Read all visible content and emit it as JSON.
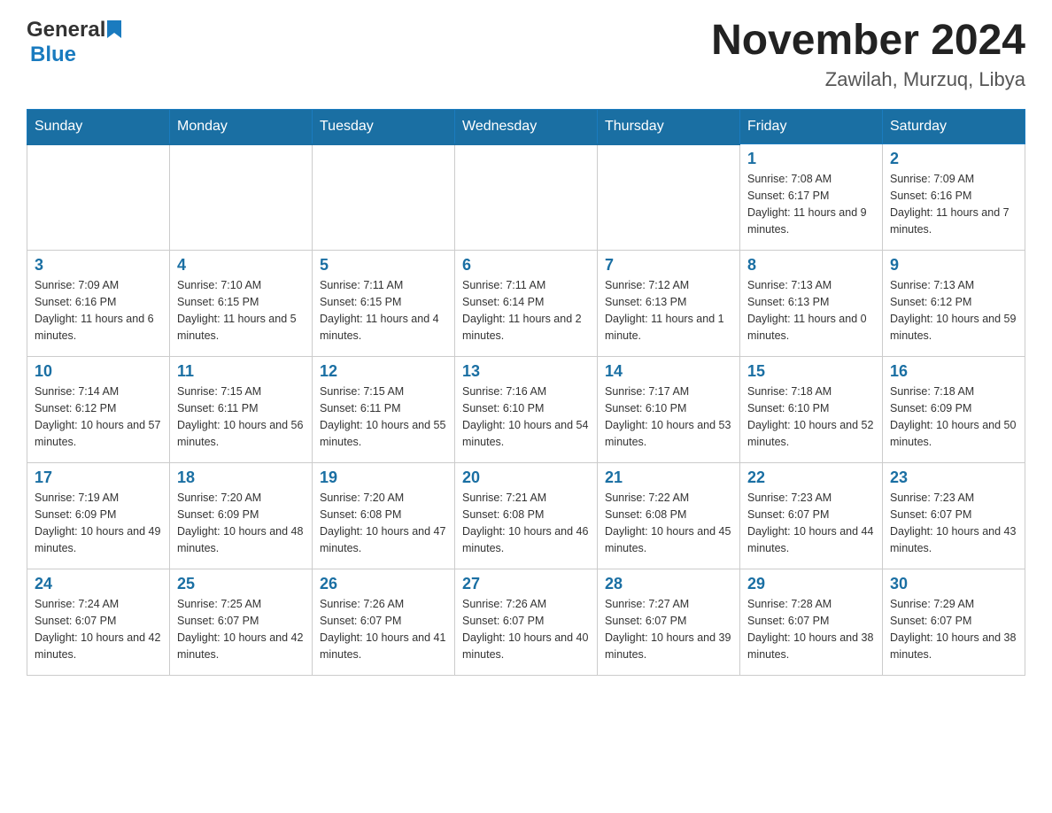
{
  "header": {
    "logo_general": "General",
    "logo_blue": "Blue",
    "month_title": "November 2024",
    "location": "Zawilah, Murzuq, Libya"
  },
  "days_of_week": [
    "Sunday",
    "Monday",
    "Tuesday",
    "Wednesday",
    "Thursday",
    "Friday",
    "Saturday"
  ],
  "weeks": [
    {
      "cells": [
        {
          "day": "",
          "info": ""
        },
        {
          "day": "",
          "info": ""
        },
        {
          "day": "",
          "info": ""
        },
        {
          "day": "",
          "info": ""
        },
        {
          "day": "",
          "info": ""
        },
        {
          "day": "1",
          "info": "Sunrise: 7:08 AM\nSunset: 6:17 PM\nDaylight: 11 hours and 9 minutes."
        },
        {
          "day": "2",
          "info": "Sunrise: 7:09 AM\nSunset: 6:16 PM\nDaylight: 11 hours and 7 minutes."
        }
      ]
    },
    {
      "cells": [
        {
          "day": "3",
          "info": "Sunrise: 7:09 AM\nSunset: 6:16 PM\nDaylight: 11 hours and 6 minutes."
        },
        {
          "day": "4",
          "info": "Sunrise: 7:10 AM\nSunset: 6:15 PM\nDaylight: 11 hours and 5 minutes."
        },
        {
          "day": "5",
          "info": "Sunrise: 7:11 AM\nSunset: 6:15 PM\nDaylight: 11 hours and 4 minutes."
        },
        {
          "day": "6",
          "info": "Sunrise: 7:11 AM\nSunset: 6:14 PM\nDaylight: 11 hours and 2 minutes."
        },
        {
          "day": "7",
          "info": "Sunrise: 7:12 AM\nSunset: 6:13 PM\nDaylight: 11 hours and 1 minute."
        },
        {
          "day": "8",
          "info": "Sunrise: 7:13 AM\nSunset: 6:13 PM\nDaylight: 11 hours and 0 minutes."
        },
        {
          "day": "9",
          "info": "Sunrise: 7:13 AM\nSunset: 6:12 PM\nDaylight: 10 hours and 59 minutes."
        }
      ]
    },
    {
      "cells": [
        {
          "day": "10",
          "info": "Sunrise: 7:14 AM\nSunset: 6:12 PM\nDaylight: 10 hours and 57 minutes."
        },
        {
          "day": "11",
          "info": "Sunrise: 7:15 AM\nSunset: 6:11 PM\nDaylight: 10 hours and 56 minutes."
        },
        {
          "day": "12",
          "info": "Sunrise: 7:15 AM\nSunset: 6:11 PM\nDaylight: 10 hours and 55 minutes."
        },
        {
          "day": "13",
          "info": "Sunrise: 7:16 AM\nSunset: 6:10 PM\nDaylight: 10 hours and 54 minutes."
        },
        {
          "day": "14",
          "info": "Sunrise: 7:17 AM\nSunset: 6:10 PM\nDaylight: 10 hours and 53 minutes."
        },
        {
          "day": "15",
          "info": "Sunrise: 7:18 AM\nSunset: 6:10 PM\nDaylight: 10 hours and 52 minutes."
        },
        {
          "day": "16",
          "info": "Sunrise: 7:18 AM\nSunset: 6:09 PM\nDaylight: 10 hours and 50 minutes."
        }
      ]
    },
    {
      "cells": [
        {
          "day": "17",
          "info": "Sunrise: 7:19 AM\nSunset: 6:09 PM\nDaylight: 10 hours and 49 minutes."
        },
        {
          "day": "18",
          "info": "Sunrise: 7:20 AM\nSunset: 6:09 PM\nDaylight: 10 hours and 48 minutes."
        },
        {
          "day": "19",
          "info": "Sunrise: 7:20 AM\nSunset: 6:08 PM\nDaylight: 10 hours and 47 minutes."
        },
        {
          "day": "20",
          "info": "Sunrise: 7:21 AM\nSunset: 6:08 PM\nDaylight: 10 hours and 46 minutes."
        },
        {
          "day": "21",
          "info": "Sunrise: 7:22 AM\nSunset: 6:08 PM\nDaylight: 10 hours and 45 minutes."
        },
        {
          "day": "22",
          "info": "Sunrise: 7:23 AM\nSunset: 6:07 PM\nDaylight: 10 hours and 44 minutes."
        },
        {
          "day": "23",
          "info": "Sunrise: 7:23 AM\nSunset: 6:07 PM\nDaylight: 10 hours and 43 minutes."
        }
      ]
    },
    {
      "cells": [
        {
          "day": "24",
          "info": "Sunrise: 7:24 AM\nSunset: 6:07 PM\nDaylight: 10 hours and 42 minutes."
        },
        {
          "day": "25",
          "info": "Sunrise: 7:25 AM\nSunset: 6:07 PM\nDaylight: 10 hours and 42 minutes."
        },
        {
          "day": "26",
          "info": "Sunrise: 7:26 AM\nSunset: 6:07 PM\nDaylight: 10 hours and 41 minutes."
        },
        {
          "day": "27",
          "info": "Sunrise: 7:26 AM\nSunset: 6:07 PM\nDaylight: 10 hours and 40 minutes."
        },
        {
          "day": "28",
          "info": "Sunrise: 7:27 AM\nSunset: 6:07 PM\nDaylight: 10 hours and 39 minutes."
        },
        {
          "day": "29",
          "info": "Sunrise: 7:28 AM\nSunset: 6:07 PM\nDaylight: 10 hours and 38 minutes."
        },
        {
          "day": "30",
          "info": "Sunrise: 7:29 AM\nSunset: 6:07 PM\nDaylight: 10 hours and 38 minutes."
        }
      ]
    }
  ]
}
